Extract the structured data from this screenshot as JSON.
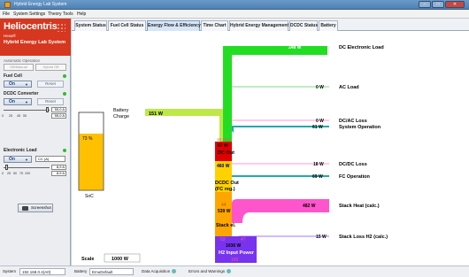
{
  "window": {
    "title": "Hybrid Energy Lab System",
    "controls": {
      "minimize": "–",
      "maximize": "□",
      "close": "✕"
    }
  },
  "menu": [
    "File",
    "System Settings",
    "Theory",
    "Tools",
    "Help"
  ],
  "brand": {
    "name": "Heliocentris",
    "subtitle_small": "Hexa®",
    "subtitle": "Hybrid Energy Lab System"
  },
  "left_panel": {
    "operation_label": "Automatic Operation",
    "operation_buttons": [
      "Off/Manual",
      "Hybrid Off"
    ],
    "fuel_cell": {
      "label": "Fuel Cell",
      "on_label": "On",
      "reset_label": "Reset"
    },
    "dcdc": {
      "label": "DCDC Converter",
      "on_label": "On",
      "reset_label": "Reset",
      "value1": "55,0 A",
      "value2": "55,0 A",
      "ticks": [
        "0",
        "25",
        "45",
        "55"
      ]
    },
    "electronic_load": {
      "label": "Electronic Load",
      "on_label": "On",
      "mode": "CC (A)",
      "value1": "8,9 A",
      "value2": "8,9 A",
      "ticks": [
        "0",
        "25",
        "50",
        "75",
        "100"
      ]
    },
    "screenshot_label": "Screenshot"
  },
  "tabs": [
    "System Status",
    "Fuel Cell Status",
    "Energy Flow & Efficiency",
    "Time Chart",
    "Hybrid Energy Management",
    "DCDC Status",
    "Battery"
  ],
  "active_tab": "Energy Flow & Efficiency",
  "energy_flow": {
    "battery": {
      "label": "Battery Charge",
      "value": "151 W",
      "soc_percent": "73 %",
      "soc_label": "SoC",
      "soc_fraction": 0.73
    },
    "scale": {
      "label": "Scale",
      "value": "1000 W"
    },
    "column": {
      "dc_out_top": "16 24.4",
      "dc_out_pct": "67 W",
      "dc_out_label": "DC Out",
      "dc_out_value": "460 W",
      "dcdc_out_label": "DCDC Out (FC reg.)",
      "stack_pct": "44",
      "stack_value": "539 W",
      "stack_label": "Stack el.",
      "h2_left_pct": "52",
      "h2_right_pct": "47",
      "h2_value": "1036 W",
      "h2_label": "H2 Input Power",
      "h2_pct": "100"
    },
    "outputs": [
      {
        "value": "248 W",
        "label": "DC Electronic Load"
      },
      {
        "value": "0 W",
        "label": "AC Load"
      },
      {
        "value": "0 W",
        "label": "DC/AC Loss"
      },
      {
        "value": "61 W",
        "label": "System Operation"
      },
      {
        "value": "18 W",
        "label": "DC/DC Loss"
      },
      {
        "value": "69 W",
        "label": "FC Operation"
      },
      {
        "value": "482 W",
        "label": "Stack Heat (calc.)"
      },
      {
        "value": "15 W",
        "label": "Stack Loss H2 (calc.)"
      }
    ],
    "colors": {
      "dc_load": "#22dd22",
      "dc_out": "#e00000",
      "battery_flow": "#bde847",
      "dcdc": "#ffd100",
      "stack": "#ffa500",
      "h2": "#7733ee",
      "heat": "#ff55cc",
      "teal": "#22aaaa",
      "pink_line": "#ff77cc",
      "violet_line": "#8844ff",
      "soc_fill": "#ffc000"
    }
  },
  "statusbar": {
    "system_label": "System",
    "system_value": "192.168.0.4(A0)",
    "battery_label": "Battery",
    "battery_value": "EmuDefault",
    "acquisition_label": "Data Acquisition",
    "errors_label": "Errors and Warnings"
  }
}
